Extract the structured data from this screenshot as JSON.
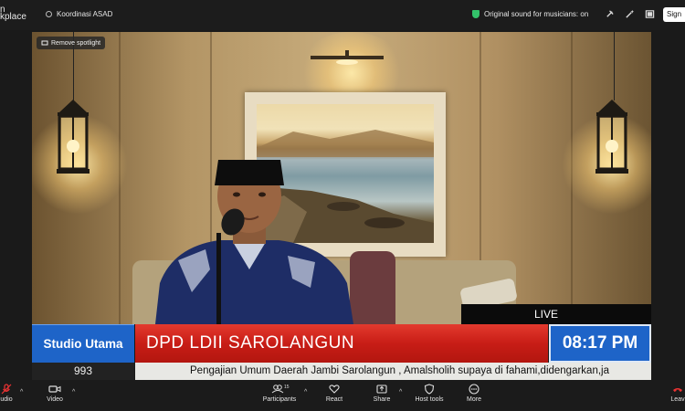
{
  "topbar": {
    "brand_line1": "n",
    "brand_line2": "kplace",
    "meeting_name": "Koordinasi ASAD",
    "sound_mode": "Original sound for musicians: on",
    "sign_label": "Sign"
  },
  "video": {
    "spotlight_label": "Remove spotlight",
    "live_label": "LIVE"
  },
  "lower_third": {
    "studio": "Studio Utama",
    "title": "DPD LDII SAROLANGUN",
    "time": "08:17 PM",
    "number": "993",
    "ticker": "Pengajian Umum Daerah Jambi Sarolangun , Amalsholih supaya di fahami,didengarkan,ja"
  },
  "toolbar": {
    "audio": "udio",
    "video": "Video",
    "participants": "Participants",
    "participants_count": "15",
    "react": "React",
    "share": "Share",
    "host_tools": "Host tools",
    "more": "More",
    "leave": "Leav"
  },
  "colors": {
    "accent_blue": "#1e64c8",
    "banner_red": "#c81d16",
    "secure_green": "#33c26a"
  }
}
